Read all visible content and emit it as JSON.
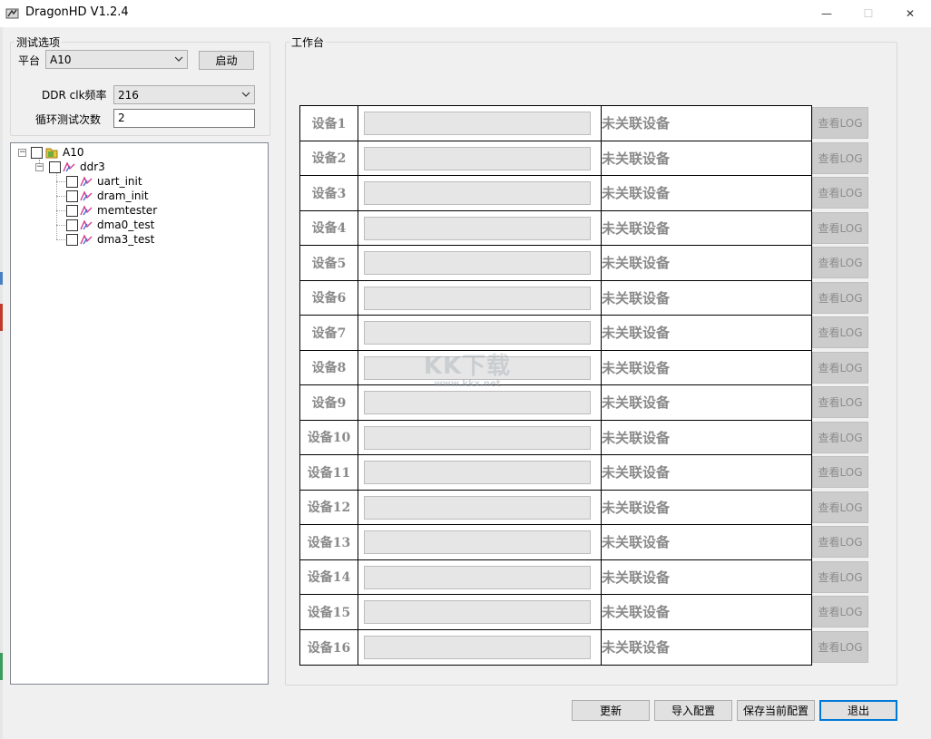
{
  "window": {
    "title": "DragonHD V1.2.4",
    "min_glyph": "—",
    "max_glyph": "☐",
    "close_glyph": "✕"
  },
  "options": {
    "legend": "测试选项",
    "platform_label": "平台",
    "platform_value": "A10",
    "start_button": "启动",
    "ddr_label": "DDR clk频率",
    "ddr_value": "216",
    "loop_label": "循环测试次数",
    "loop_value": "2"
  },
  "tree": {
    "root": "A10",
    "child": "ddr3",
    "items": [
      "uart_init",
      "dram_init",
      "memtester",
      "dma0_test",
      "dma3_test"
    ]
  },
  "workbench": {
    "legend": "工作台",
    "devices": [
      {
        "name": "设备1",
        "status": "未关联设备",
        "log": "查看LOG"
      },
      {
        "name": "设备2",
        "status": "未关联设备",
        "log": "查看LOG"
      },
      {
        "name": "设备3",
        "status": "未关联设备",
        "log": "查看LOG"
      },
      {
        "name": "设备4",
        "status": "未关联设备",
        "log": "查看LOG"
      },
      {
        "name": "设备5",
        "status": "未关联设备",
        "log": "查看LOG"
      },
      {
        "name": "设备6",
        "status": "未关联设备",
        "log": "查看LOG"
      },
      {
        "name": "设备7",
        "status": "未关联设备",
        "log": "查看LOG"
      },
      {
        "name": "设备8",
        "status": "未关联设备",
        "log": "查看LOG"
      },
      {
        "name": "设备9",
        "status": "未关联设备",
        "log": "查看LOG"
      },
      {
        "name": "设备10",
        "status": "未关联设备",
        "log": "查看LOG"
      },
      {
        "name": "设备11",
        "status": "未关联设备",
        "log": "查看LOG"
      },
      {
        "name": "设备12",
        "status": "未关联设备",
        "log": "查看LOG"
      },
      {
        "name": "设备13",
        "status": "未关联设备",
        "log": "查看LOG"
      },
      {
        "name": "设备14",
        "status": "未关联设备",
        "log": "查看LOG"
      },
      {
        "name": "设备15",
        "status": "未关联设备",
        "log": "查看LOG"
      },
      {
        "name": "设备16",
        "status": "未关联设备",
        "log": "查看LOG"
      }
    ]
  },
  "footer": {
    "refresh": "更新",
    "import_config": "导入配置",
    "save_config": "保存当前配置",
    "exit": "退出"
  },
  "watermark": {
    "logo": "KK下载",
    "url": "www.kkx.net"
  },
  "colors": {
    "accent": "#0078d7",
    "status_text": "#8a8a8a",
    "log_button": "#cccccc"
  },
  "icons": [
    "app-dragon-icon",
    "chevron-down-icon",
    "folder-icon",
    "test-item-icon"
  ]
}
